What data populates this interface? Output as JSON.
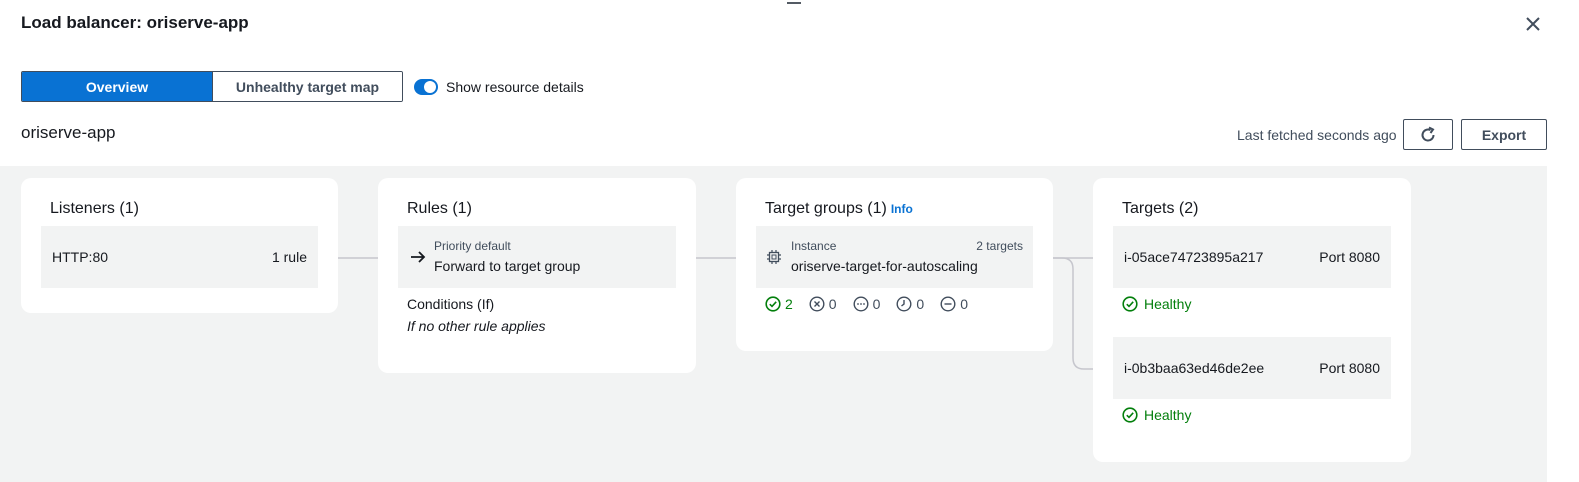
{
  "header": {
    "title": "Load balancer: oriserve-app"
  },
  "view_tabs": [
    {
      "label": "Overview",
      "selected": true
    },
    {
      "label": "Unhealthy target map",
      "selected": false
    }
  ],
  "toggle": {
    "label": "Show resource details",
    "on": true
  },
  "resource_name": "oriserve-app",
  "toolbar": {
    "fetched": "Last fetched seconds ago",
    "export_label": "Export"
  },
  "listeners": {
    "title": "Listeners (1)",
    "items": [
      {
        "name": "HTTP:80",
        "rules": "1 rule"
      }
    ]
  },
  "rules": {
    "title": "Rules (1)",
    "items": [
      {
        "priority": "Priority default",
        "action": "Forward to target group"
      }
    ],
    "conditions_title": "Conditions (If)",
    "conditions_text": "If no other rule applies"
  },
  "target_groups": {
    "title": "Target groups (1)",
    "info": "Info",
    "items": [
      {
        "type": "Instance",
        "count": "2 targets",
        "name": "oriserve-target-for-autoscaling"
      }
    ],
    "stats": {
      "healthy": "2",
      "unhealthy": "0",
      "unused": "0",
      "initial": "0",
      "draining": "0"
    }
  },
  "targets": {
    "title": "Targets (2)",
    "items": [
      {
        "id": "i-05ace74723895a217",
        "port": "Port 8080",
        "status": "Healthy"
      },
      {
        "id": "i-0b3baa63ed46de2ee",
        "port": "Port 8080",
        "status": "Healthy"
      }
    ]
  },
  "colors": {
    "accent": "#0972d3",
    "healthy": "#037f0c",
    "canvas": "#f2f3f3"
  },
  "icons": [
    "close-icon",
    "drag-handle-icon",
    "refresh-icon",
    "arrow-right-icon",
    "chip-icon",
    "check-circle-icon",
    "x-circle-icon",
    "dots-circle-icon",
    "clock-circle-icon",
    "minus-circle-icon"
  ]
}
